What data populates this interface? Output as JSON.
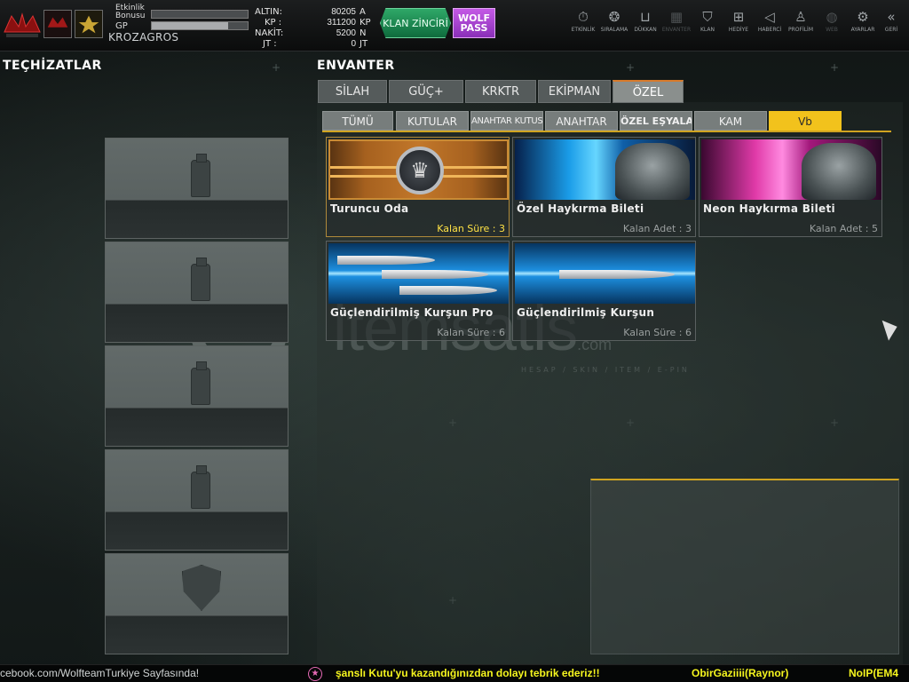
{
  "player": {
    "event_bonus_label": "Etkinlik Bonusu",
    "gp_label": "GP",
    "event_bonus_fill": 0,
    "gp_fill": 0.8,
    "username": "KROZAGROS"
  },
  "currency": [
    {
      "key": "ALTIN:",
      "value": "80205",
      "unit": "A"
    },
    {
      "key": "KP :",
      "value": "311200",
      "unit": "KP"
    },
    {
      "key": "NAKİT:",
      "value": "5200",
      "unit": "N"
    },
    {
      "key": "JT :",
      "value": "0",
      "unit": "JT"
    }
  ],
  "buttons": {
    "clan_chain": "KLAN ZİNCİRİ",
    "wolf_pass_1": "WOLF",
    "wolf_pass_2": "PASS"
  },
  "nav": [
    {
      "label": "ETKİNLİK",
      "icon": "stopwatch-icon"
    },
    {
      "label": "SIRALAMA",
      "icon": "medal-icon"
    },
    {
      "label": "DÜKKAN",
      "icon": "cart-icon"
    },
    {
      "label": "ENVANTER",
      "icon": "inventory-icon"
    },
    {
      "label": "KLAN",
      "icon": "clan-shield-icon"
    },
    {
      "label": "HEDİYE",
      "icon": "gift-icon"
    },
    {
      "label": "HABERCİ",
      "icon": "megaphone-icon"
    },
    {
      "label": "PROFİLİM",
      "icon": "profile-icon"
    },
    {
      "label": "WEB",
      "icon": "globe-icon"
    },
    {
      "label": "AYARLAR",
      "icon": "gear-icon"
    },
    {
      "label": "GERİ",
      "icon": "back-chevrons-icon"
    }
  ],
  "equipment": {
    "title": "TEÇHİZATLAR"
  },
  "inventory": {
    "title": "ENVANTER",
    "tabs": [
      "SİLAH",
      "GÜÇ+",
      "KRKTR",
      "EKİPMAN",
      "ÖZEL"
    ],
    "active_tab": "ÖZEL",
    "subtabs": [
      "TÜMÜ",
      "KUTULAR",
      "ANAHTAR KUTUSU",
      "ANAHTAR",
      "ÖZEL EŞYALAR",
      "KAM",
      "Vb"
    ],
    "active_subtab": "Vb",
    "items": [
      {
        "name": "Turuncu Oda",
        "meta": "Kalan Süre : 3"
      },
      {
        "name": "Özel Haykırma Bileti",
        "meta": "Kalan Adet : 3"
      },
      {
        "name": "Neon Haykırma Bileti",
        "meta": "Kalan Adet : 5"
      },
      {
        "name": "Güçlendirilmiş Kurşun Pro",
        "meta": "Kalan Süre : 6"
      },
      {
        "name": "Güçlendirilmiş Kurşun",
        "meta": "Kalan Süre : 6"
      }
    ]
  },
  "watermark": {
    "text": "itemsatis",
    "suffix": ".com",
    "sub": "HESAP / SKIN / ITEM / E-PIN"
  },
  "ticker": {
    "left": "cebook.com/WolfteamTurkiye Sayfasında!",
    "message": "şanslı Kutu'yu kazandığınızdan dolayı tebrik ederiz!!",
    "player1": "ObirGaziiii(Raynor)",
    "player2": "NoIP(EM4"
  },
  "colors": {
    "accent_yellow": "#f2c21c",
    "clan_green": "#1f8a52",
    "wolf_purple": "#b04ad8",
    "ticker_green": "#3cff3c",
    "ticker_yellow": "#f5f51e"
  }
}
